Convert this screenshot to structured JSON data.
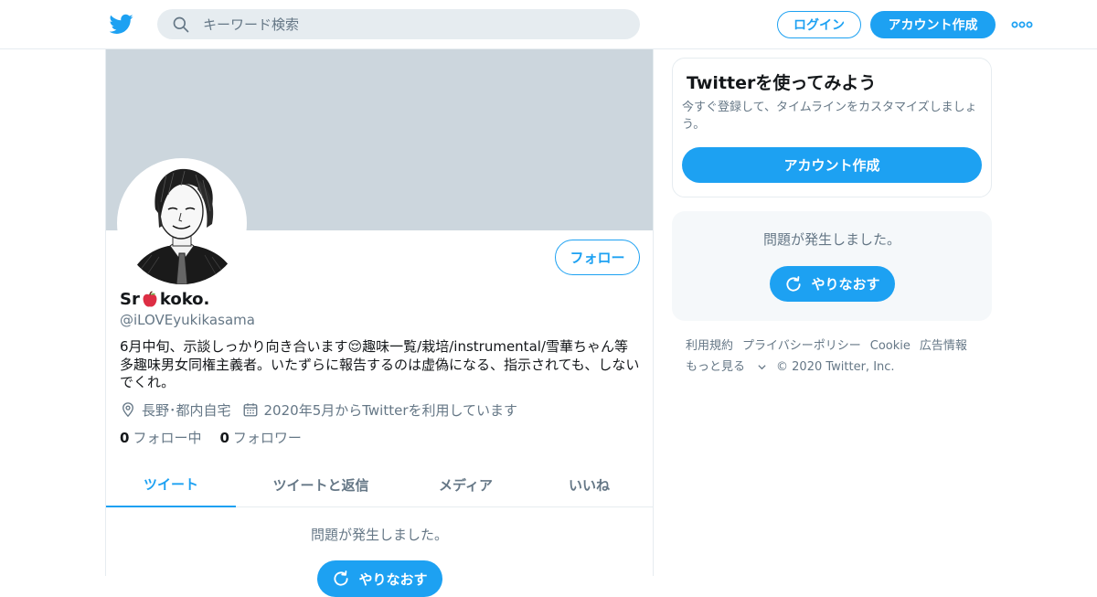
{
  "colors": {
    "accent": "#1da1f2",
    "banner": "#ccd6dd",
    "muted": "#657786",
    "text": "#14171a",
    "border": "#e6ecf0"
  },
  "header": {
    "logo_icon": "twitter-bird-icon",
    "search": {
      "placeholder": "キーワード検索",
      "value": "",
      "icon": "search-icon"
    },
    "login_label": "ログイン",
    "signup_label": "アカウント作成",
    "more_icon": "more-dots-icon"
  },
  "profile": {
    "display_name_prefix": "Sr",
    "display_name_emoji": "🍎",
    "display_name_suffix": "koko.",
    "username": "@iLOVEyukikasama",
    "follow_label": "フォロー",
    "bio": "6月中旬、示談しっかり向き合います😌趣味一覧/栽培/instrumental/雪華ちゃん等多趣味男女同権主義者。いたずらに報告するのは虚偽になる、指示されても、しないでくれ。",
    "location": "長野･都内自宅",
    "location_icon": "location-pin-icon",
    "joined": "2020年5月からTwitterを利用しています",
    "joined_icon": "calendar-icon",
    "following_count": "0",
    "following_label": "フォロー中",
    "followers_count": "0",
    "followers_label": "フォロワー"
  },
  "tabs": [
    {
      "label": "ツイート",
      "active": true
    },
    {
      "label": "ツイートと返信",
      "active": false
    },
    {
      "label": "メディア",
      "active": false
    },
    {
      "label": "いいね",
      "active": false
    }
  ],
  "timeline": {
    "error_message": "問題が発生しました。",
    "retry_label": "やりなおす"
  },
  "sidebar": {
    "signup_card": {
      "title": "Twitterを使ってみよう",
      "description": "今すぐ登録して、タイムラインをカスタマイズしましょう。",
      "button_label": "アカウント作成"
    },
    "error_card": {
      "message": "問題が発生しました。",
      "retry_label": "やりなおす",
      "retry_icon": "refresh-icon"
    },
    "footer": {
      "links": [
        "利用規約",
        "プライバシーポリシー",
        "Cookie",
        "広告情報"
      ],
      "more_label": "もっと見る",
      "copyright": "© 2020 Twitter, Inc."
    }
  }
}
